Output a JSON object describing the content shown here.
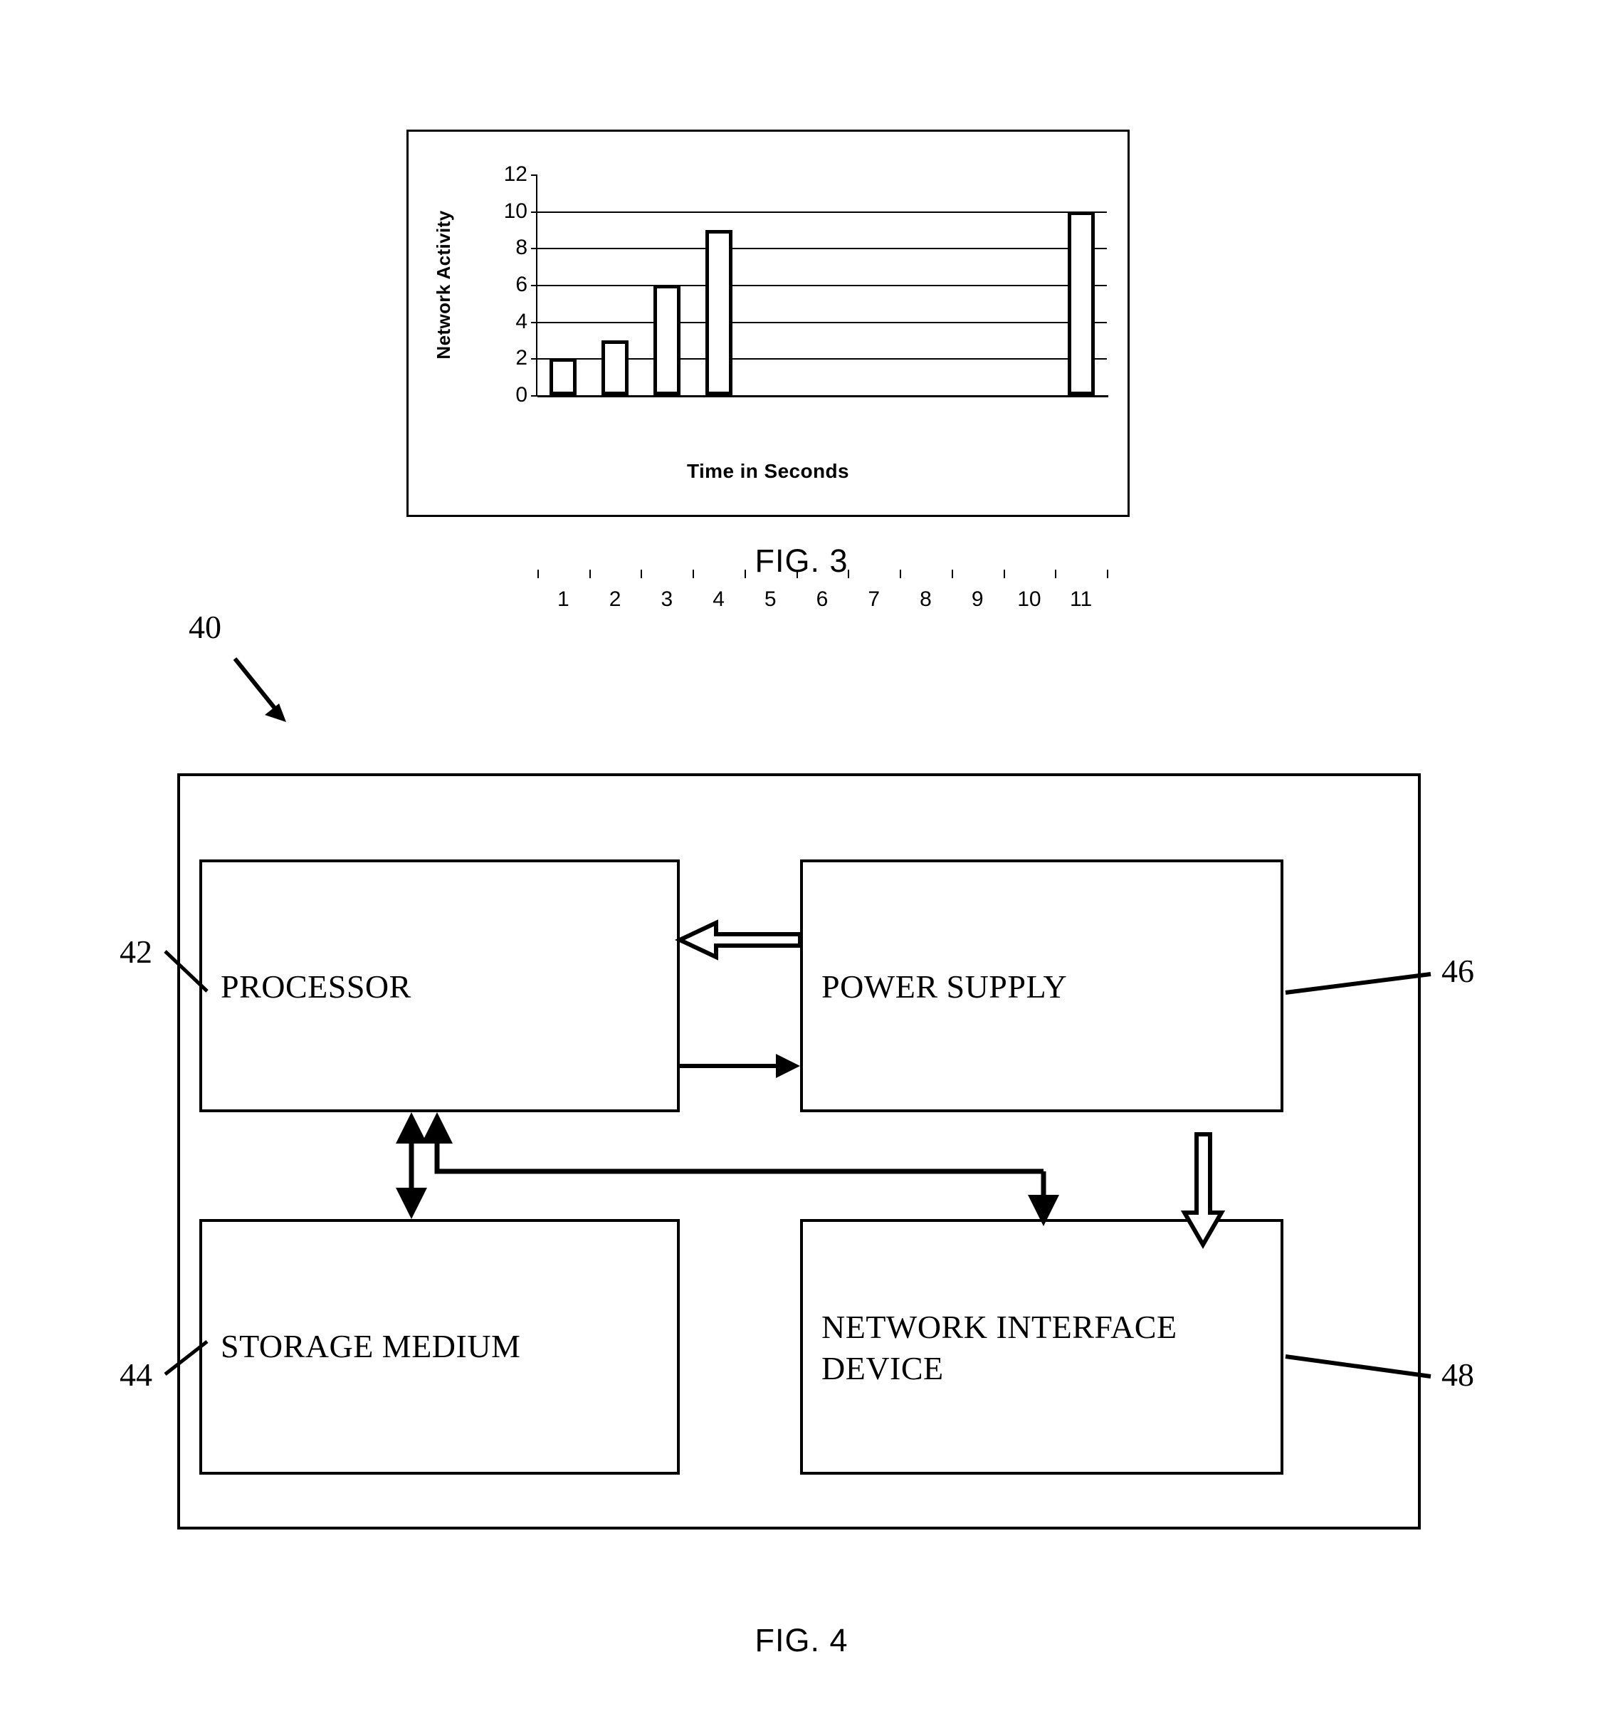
{
  "figures": [
    {
      "id": "fig3",
      "caption": "FIG. 3"
    },
    {
      "id": "fig4",
      "caption": "FIG. 4"
    }
  ],
  "fig3": {
    "caption": "FIG. 3"
  },
  "chart_data": {
    "type": "bar",
    "title": "",
    "xlabel": "Time in Seconds",
    "ylabel": "Network Activity",
    "categories": [
      "1",
      "2",
      "3",
      "4",
      "5",
      "6",
      "7",
      "8",
      "9",
      "10",
      "11"
    ],
    "values": [
      2,
      3,
      6,
      9,
      0,
      0,
      0,
      0,
      0,
      0,
      10
    ],
    "yticks": [
      "0",
      "2",
      "4",
      "6",
      "8",
      "10",
      "12"
    ],
    "ylim": [
      0,
      12
    ],
    "grid": true,
    "legend": "none",
    "bar_color": "#ffffff",
    "bar_border_color": "#000000",
    "axis_color": "#000000"
  },
  "fig4": {
    "caption": "FIG. 4",
    "system_ref": "40",
    "blocks": [
      {
        "name": "processor",
        "label": "PROCESSOR",
        "ref": "42"
      },
      {
        "name": "power-supply",
        "label": "POWER SUPPLY",
        "ref": "46"
      },
      {
        "name": "storage-medium",
        "label": "STORAGE MEDIUM",
        "ref": "44"
      },
      {
        "name": "network-interface",
        "label": "NETWORK INTERFACE DEVICE",
        "ref": "48"
      }
    ],
    "network_label_line1": "NETWORK INTERFACE",
    "network_label_line2": "DEVICE",
    "connections": [
      {
        "from": "power-supply",
        "to": "processor",
        "style": "hollow-block-arrow",
        "direction": "left"
      },
      {
        "from": "processor",
        "to": "power-supply",
        "style": "solid-thin-arrow",
        "direction": "right"
      },
      {
        "from": "processor",
        "to": "storage-medium",
        "style": "solid-double-arrow",
        "direction": "vertical"
      },
      {
        "from": "network-interface",
        "to": "processor",
        "style": "solid-thin-arrow",
        "direction": "up-left"
      },
      {
        "from": "processor",
        "to": "network-interface",
        "style": "solid-thin-arrow",
        "direction": "down-right"
      },
      {
        "from": "power-supply",
        "to": "network-interface",
        "style": "hollow-block-arrow",
        "direction": "down"
      }
    ]
  }
}
